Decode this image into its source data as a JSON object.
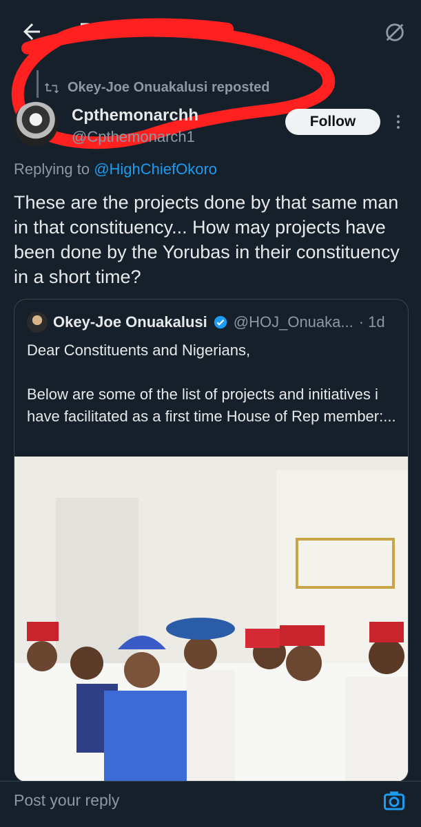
{
  "header": {
    "title": "Post"
  },
  "repost": {
    "text": "Okey-Joe Onuakalusi reposted"
  },
  "author": {
    "name": "Cpthemonarchh",
    "handle": "@Cpthemonarch1"
  },
  "follow_label": "Follow",
  "replying": {
    "prefix": "Replying to ",
    "handle": "@HighChiefOkoro"
  },
  "post_text": "These are the projects done by that same man in that constituency... How may projects have been done by the Yorubas in their constituency in a short time?",
  "quote": {
    "name": "Okey-Joe Onuakalusi",
    "handle": "@HOJ_Onuaka...",
    "time": "· 1d",
    "text": "Dear Constituents and Nigerians,\n\nBelow are some of the list of projects and initiatives i have facilitated as a first time House of Rep member:..."
  },
  "reply": {
    "placeholder": "Post your reply"
  },
  "colors": {
    "accent": "#1d9bf0",
    "background": "#15202b",
    "annotation": "#ff2020"
  },
  "icons": [
    "back-arrow-icon",
    "grok-icon",
    "repost-icon",
    "more-icon",
    "verified-icon",
    "camera-icon"
  ]
}
